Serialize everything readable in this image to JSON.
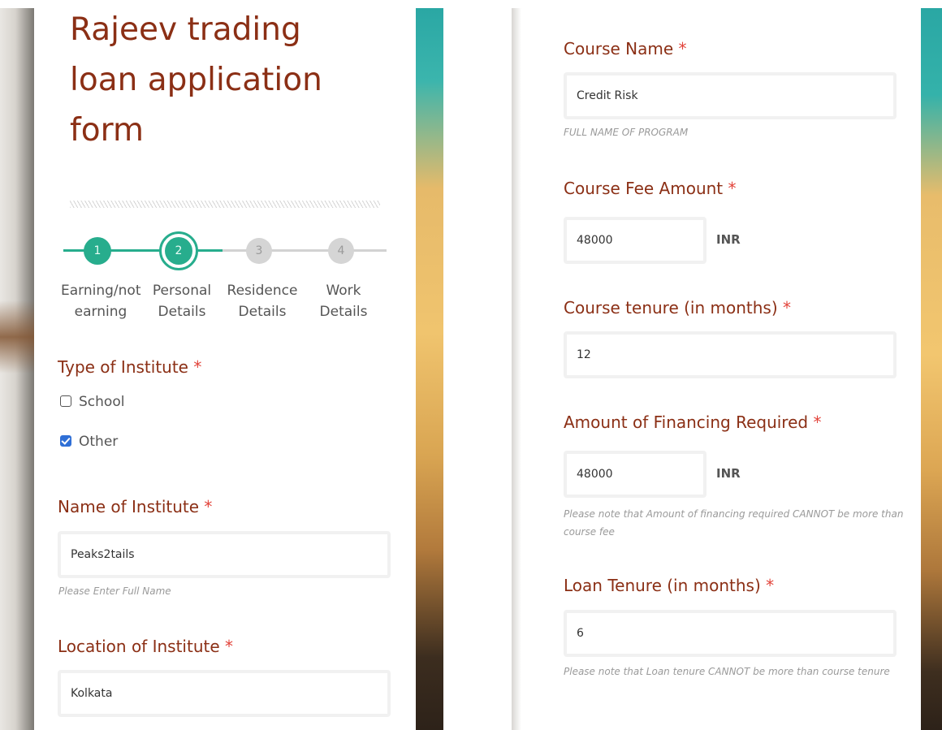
{
  "form": {
    "title": "Rajeev trading loan application form"
  },
  "stepper": {
    "steps": [
      {
        "number": "1",
        "label": "Earning/not earning",
        "status": "completed"
      },
      {
        "number": "2",
        "label": "Personal Details",
        "status": "current"
      },
      {
        "number": "3",
        "label": "Residence Details",
        "status": "upcoming"
      },
      {
        "number": "4",
        "label": "Work Details",
        "status": "upcoming"
      }
    ]
  },
  "fields": {
    "required_marker": "*",
    "type_of_institute": {
      "label": "Type of Institute",
      "options": [
        {
          "label": "School",
          "checked": false
        },
        {
          "label": "Other",
          "checked": true
        }
      ]
    },
    "name_of_institute": {
      "label": "Name of Institute",
      "value": "Peaks2tails",
      "help": "Please Enter Full Name"
    },
    "location_of_institute": {
      "label": "Location of Institute",
      "value": "Kolkata"
    },
    "course_name": {
      "label": "Course Name",
      "value": "Credit Risk",
      "help": "FULL NAME OF PROGRAM"
    },
    "course_fee_amount": {
      "label": "Course Fee Amount",
      "value": "48000",
      "unit": "INR"
    },
    "course_tenure": {
      "label": "Course tenure (in months)",
      "value": "12"
    },
    "amount_of_financing": {
      "label": "Amount of Financing Required",
      "value": "48000",
      "unit": "INR",
      "help": "Please note that Amount of financing required CANNOT be more than course fee"
    },
    "loan_tenure": {
      "label": "Loan Tenure (in months)",
      "value": "6",
      "help": "Please note that Loan tenure CANNOT be more than course tenure"
    }
  },
  "colors": {
    "label": "#8b2f15",
    "required": "#e2433a",
    "step_active": "#27ad8d",
    "step_inactive": "#d5d5d5",
    "checkbox_checked": "#2f6fd6"
  }
}
